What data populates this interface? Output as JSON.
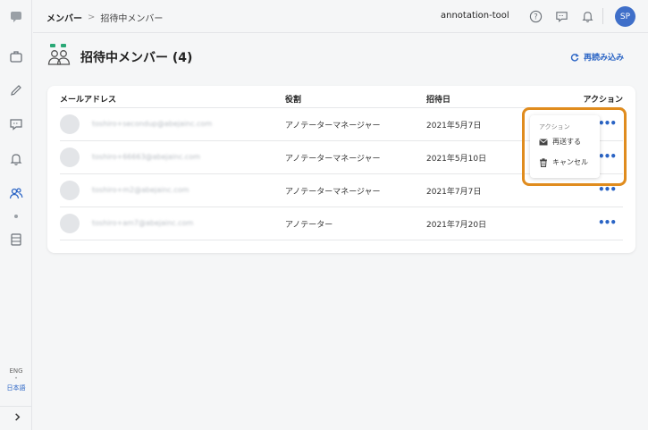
{
  "sidebar": {
    "icons": [
      "chat-logo-icon",
      "briefcase-icon",
      "pencil-icon",
      "message-icon",
      "bell-icon",
      "users-icon",
      "storage-icon"
    ],
    "lang_eng": "ENG",
    "lang_sep": "•",
    "lang_ja": "日本語"
  },
  "header": {
    "breadcrumb_1": "メンバー",
    "breadcrumb_sep": ">",
    "breadcrumb_2": "招待中メンバー",
    "org": "annotation-tool",
    "avatar": "SP"
  },
  "page": {
    "title": "招待中メンバー (4)",
    "reload": "再読み込み"
  },
  "table": {
    "headers": {
      "email": "メールアドレス",
      "role": "役割",
      "invited": "招待日",
      "action": "アクション"
    },
    "rows": [
      {
        "email": "toshiro+secondup@abejainc.com",
        "role": "アノテーターマネージャー",
        "date": "2021年5月7日",
        "more": "•••"
      },
      {
        "email": "toshiro+66663@abejainc.com",
        "role": "アノテーターマネージャー",
        "date": "2021年5月10日",
        "more": "•••"
      },
      {
        "email": "toshiro+m2@abejainc.com",
        "role": "アノテーターマネージャー",
        "date": "2021年7月7日",
        "more": "•••"
      },
      {
        "email": "toshiro+am7@abejainc.com",
        "role": "アノテーター",
        "date": "2021年7月20日",
        "more": "•••"
      }
    ]
  },
  "action_menu": {
    "title": "アクション",
    "resend": "再送する",
    "cancel": "キャンセル"
  },
  "colors": {
    "accent": "#2a64c5",
    "highlight": "#e08c1e",
    "avatar_bg": "#3f6fc9"
  }
}
